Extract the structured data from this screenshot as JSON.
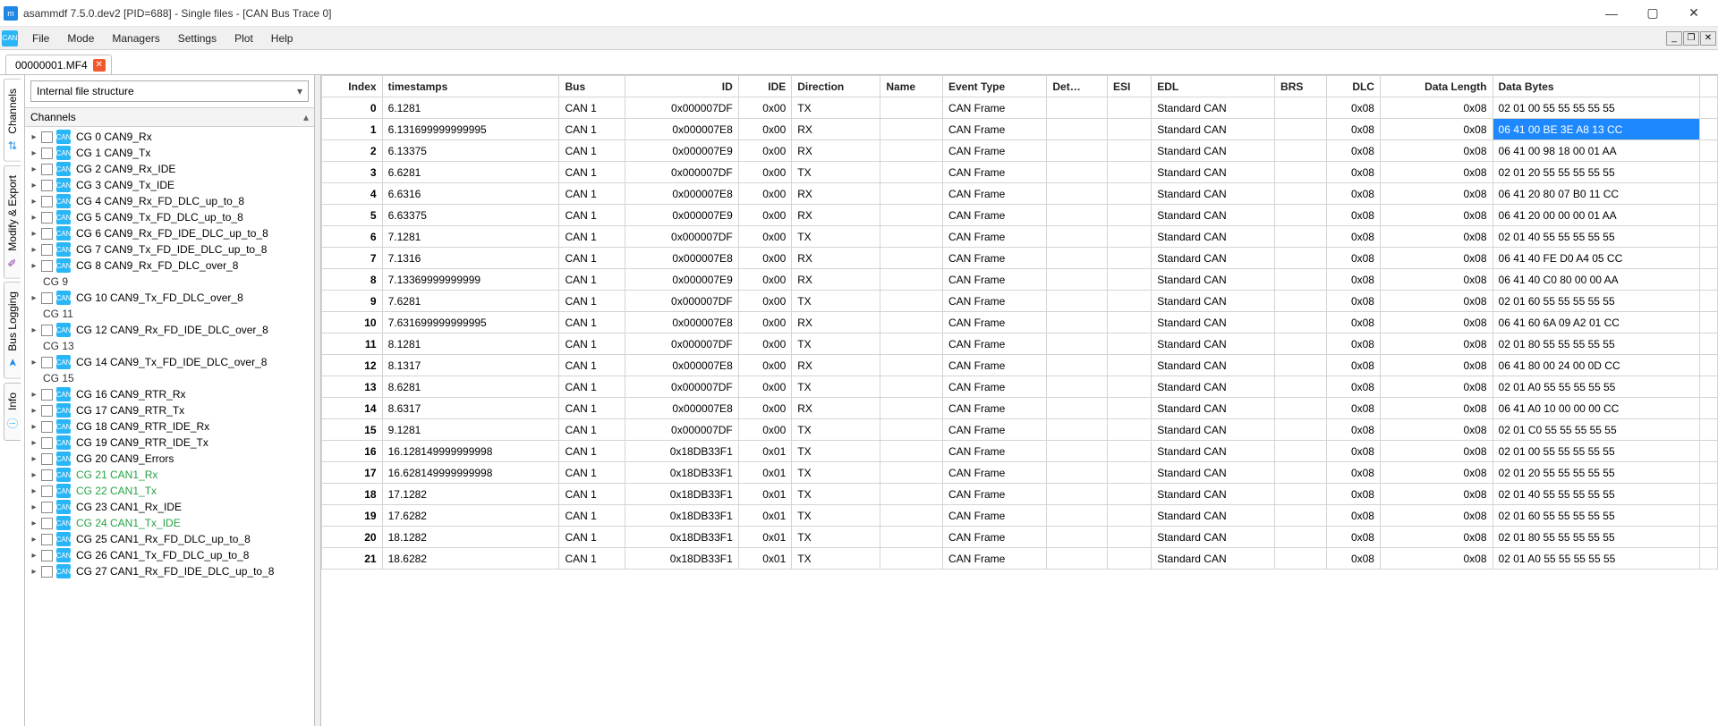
{
  "window": {
    "title": "asammdf 7.5.0.dev2 [PID=688] - Single files - [CAN Bus Trace 0]"
  },
  "menu": {
    "items": [
      "File",
      "Mode",
      "Managers",
      "Settings",
      "Plot",
      "Help"
    ]
  },
  "filetab": {
    "name": "00000001.MF4"
  },
  "side_tabs": [
    "Channels",
    "Modify & Export",
    "Bus Logging",
    "Info"
  ],
  "combo": {
    "value": "Internal file structure"
  },
  "panel_header": "Channels",
  "tree": [
    {
      "label": "CG 0 CAN9_Rx",
      "leaf": true
    },
    {
      "label": "CG 1 CAN9_Tx",
      "leaf": true
    },
    {
      "label": "CG 2 CAN9_Rx_IDE",
      "leaf": true
    },
    {
      "label": "CG 3 CAN9_Tx_IDE",
      "leaf": true
    },
    {
      "label": "CG 4 CAN9_Rx_FD_DLC_up_to_8",
      "leaf": true
    },
    {
      "label": "CG 5 CAN9_Tx_FD_DLC_up_to_8",
      "leaf": true
    },
    {
      "label": "CG 6 CAN9_Rx_FD_IDE_DLC_up_to_8",
      "leaf": true
    },
    {
      "label": "CG 7 CAN9_Tx_FD_IDE_DLC_up_to_8",
      "leaf": true
    },
    {
      "label": "CG 8 CAN9_Rx_FD_DLC_over_8",
      "leaf": true
    },
    {
      "label": "CG 9",
      "group": true
    },
    {
      "label": "CG 10 CAN9_Tx_FD_DLC_over_8",
      "leaf": true
    },
    {
      "label": "CG 11",
      "group": true
    },
    {
      "label": "CG 12 CAN9_Rx_FD_IDE_DLC_over_8",
      "leaf": true
    },
    {
      "label": "CG 13",
      "group": true
    },
    {
      "label": "CG 14 CAN9_Tx_FD_IDE_DLC_over_8",
      "leaf": true
    },
    {
      "label": "CG 15",
      "group": true
    },
    {
      "label": "CG 16 CAN9_RTR_Rx",
      "leaf": true
    },
    {
      "label": "CG 17 CAN9_RTR_Tx",
      "leaf": true
    },
    {
      "label": "CG 18 CAN9_RTR_IDE_Rx",
      "leaf": true
    },
    {
      "label": "CG 19 CAN9_RTR_IDE_Tx",
      "leaf": true
    },
    {
      "label": "CG 20 CAN9_Errors",
      "leaf": true
    },
    {
      "label": "CG 21 CAN1_Rx",
      "leaf": true,
      "hl": true
    },
    {
      "label": "CG 22 CAN1_Tx",
      "leaf": true,
      "hl": true
    },
    {
      "label": "CG 23 CAN1_Rx_IDE",
      "leaf": true
    },
    {
      "label": "CG 24 CAN1_Tx_IDE",
      "leaf": true,
      "hl": true
    },
    {
      "label": "CG 25 CAN1_Rx_FD_DLC_up_to_8",
      "leaf": true
    },
    {
      "label": "CG 26 CAN1_Tx_FD_DLC_up_to_8",
      "leaf": true
    },
    {
      "label": "CG 27 CAN1_Rx_FD_IDE_DLC_up_to_8",
      "leaf": true
    }
  ],
  "table": {
    "headers": [
      "Index",
      "timestamps",
      "Bus",
      "ID",
      "IDE",
      "Direction",
      "Name",
      "Event Type",
      "Det…",
      "ESI",
      "EDL",
      "BRS",
      "DLC",
      "Data Length",
      "Data Bytes"
    ],
    "align": [
      "right",
      "left",
      "left",
      "right",
      "right",
      "left",
      "left",
      "left",
      "left",
      "left",
      "left",
      "left",
      "right",
      "right",
      "left"
    ],
    "rows": [
      {
        "idx": "0",
        "ts": "6.1281",
        "bus": "CAN 1",
        "id": "0x000007DF",
        "ide": "0x00",
        "dir": "TX",
        "evt": "CAN Frame",
        "edl": "Standard CAN",
        "dlc": "0x08",
        "dlen": "0x08",
        "data": "02 01 00 55 55 55 55 55"
      },
      {
        "idx": "1",
        "ts": "6.131699999999995",
        "bus": "CAN 1",
        "id": "0x000007E8",
        "ide": "0x00",
        "dir": "RX",
        "evt": "CAN Frame",
        "edl": "Standard CAN",
        "dlc": "0x08",
        "dlen": "0x08",
        "data": "06 41 00 BE 3E A8 13 CC",
        "sel": true
      },
      {
        "idx": "2",
        "ts": "6.13375",
        "bus": "CAN 1",
        "id": "0x000007E9",
        "ide": "0x00",
        "dir": "RX",
        "evt": "CAN Frame",
        "edl": "Standard CAN",
        "dlc": "0x08",
        "dlen": "0x08",
        "data": "06 41 00 98 18 00 01 AA"
      },
      {
        "idx": "3",
        "ts": "6.6281",
        "bus": "CAN 1",
        "id": "0x000007DF",
        "ide": "0x00",
        "dir": "TX",
        "evt": "CAN Frame",
        "edl": "Standard CAN",
        "dlc": "0x08",
        "dlen": "0x08",
        "data": "02 01 20 55 55 55 55 55"
      },
      {
        "idx": "4",
        "ts": "6.6316",
        "bus": "CAN 1",
        "id": "0x000007E8",
        "ide": "0x00",
        "dir": "RX",
        "evt": "CAN Frame",
        "edl": "Standard CAN",
        "dlc": "0x08",
        "dlen": "0x08",
        "data": "06 41 20 80 07 B0 11 CC"
      },
      {
        "idx": "5",
        "ts": "6.63375",
        "bus": "CAN 1",
        "id": "0x000007E9",
        "ide": "0x00",
        "dir": "RX",
        "evt": "CAN Frame",
        "edl": "Standard CAN",
        "dlc": "0x08",
        "dlen": "0x08",
        "data": "06 41 20 00 00 00 01 AA"
      },
      {
        "idx": "6",
        "ts": "7.1281",
        "bus": "CAN 1",
        "id": "0x000007DF",
        "ide": "0x00",
        "dir": "TX",
        "evt": "CAN Frame",
        "edl": "Standard CAN",
        "dlc": "0x08",
        "dlen": "0x08",
        "data": "02 01 40 55 55 55 55 55"
      },
      {
        "idx": "7",
        "ts": "7.1316",
        "bus": "CAN 1",
        "id": "0x000007E8",
        "ide": "0x00",
        "dir": "RX",
        "evt": "CAN Frame",
        "edl": "Standard CAN",
        "dlc": "0x08",
        "dlen": "0x08",
        "data": "06 41 40 FE D0 A4 05 CC"
      },
      {
        "idx": "8",
        "ts": "7.13369999999999",
        "bus": "CAN 1",
        "id": "0x000007E9",
        "ide": "0x00",
        "dir": "RX",
        "evt": "CAN Frame",
        "edl": "Standard CAN",
        "dlc": "0x08",
        "dlen": "0x08",
        "data": "06 41 40 C0 80 00 00 AA"
      },
      {
        "idx": "9",
        "ts": "7.6281",
        "bus": "CAN 1",
        "id": "0x000007DF",
        "ide": "0x00",
        "dir": "TX",
        "evt": "CAN Frame",
        "edl": "Standard CAN",
        "dlc": "0x08",
        "dlen": "0x08",
        "data": "02 01 60 55 55 55 55 55"
      },
      {
        "idx": "10",
        "ts": "7.631699999999995",
        "bus": "CAN 1",
        "id": "0x000007E8",
        "ide": "0x00",
        "dir": "RX",
        "evt": "CAN Frame",
        "edl": "Standard CAN",
        "dlc": "0x08",
        "dlen": "0x08",
        "data": "06 41 60 6A 09 A2 01 CC"
      },
      {
        "idx": "11",
        "ts": "8.1281",
        "bus": "CAN 1",
        "id": "0x000007DF",
        "ide": "0x00",
        "dir": "TX",
        "evt": "CAN Frame",
        "edl": "Standard CAN",
        "dlc": "0x08",
        "dlen": "0x08",
        "data": "02 01 80 55 55 55 55 55"
      },
      {
        "idx": "12",
        "ts": "8.1317",
        "bus": "CAN 1",
        "id": "0x000007E8",
        "ide": "0x00",
        "dir": "RX",
        "evt": "CAN Frame",
        "edl": "Standard CAN",
        "dlc": "0x08",
        "dlen": "0x08",
        "data": "06 41 80 00 24 00 0D CC"
      },
      {
        "idx": "13",
        "ts": "8.6281",
        "bus": "CAN 1",
        "id": "0x000007DF",
        "ide": "0x00",
        "dir": "TX",
        "evt": "CAN Frame",
        "edl": "Standard CAN",
        "dlc": "0x08",
        "dlen": "0x08",
        "data": "02 01 A0 55 55 55 55 55"
      },
      {
        "idx": "14",
        "ts": "8.6317",
        "bus": "CAN 1",
        "id": "0x000007E8",
        "ide": "0x00",
        "dir": "RX",
        "evt": "CAN Frame",
        "edl": "Standard CAN",
        "dlc": "0x08",
        "dlen": "0x08",
        "data": "06 41 A0 10 00 00 00 CC"
      },
      {
        "idx": "15",
        "ts": "9.1281",
        "bus": "CAN 1",
        "id": "0x000007DF",
        "ide": "0x00",
        "dir": "TX",
        "evt": "CAN Frame",
        "edl": "Standard CAN",
        "dlc": "0x08",
        "dlen": "0x08",
        "data": "02 01 C0 55 55 55 55 55"
      },
      {
        "idx": "16",
        "ts": "16.128149999999998",
        "bus": "CAN 1",
        "id": "0x18DB33F1",
        "ide": "0x01",
        "dir": "TX",
        "evt": "CAN Frame",
        "edl": "Standard CAN",
        "dlc": "0x08",
        "dlen": "0x08",
        "data": "02 01 00 55 55 55 55 55"
      },
      {
        "idx": "17",
        "ts": "16.628149999999998",
        "bus": "CAN 1",
        "id": "0x18DB33F1",
        "ide": "0x01",
        "dir": "TX",
        "evt": "CAN Frame",
        "edl": "Standard CAN",
        "dlc": "0x08",
        "dlen": "0x08",
        "data": "02 01 20 55 55 55 55 55"
      },
      {
        "idx": "18",
        "ts": "17.1282",
        "bus": "CAN 1",
        "id": "0x18DB33F1",
        "ide": "0x01",
        "dir": "TX",
        "evt": "CAN Frame",
        "edl": "Standard CAN",
        "dlc": "0x08",
        "dlen": "0x08",
        "data": "02 01 40 55 55 55 55 55"
      },
      {
        "idx": "19",
        "ts": "17.6282",
        "bus": "CAN 1",
        "id": "0x18DB33F1",
        "ide": "0x01",
        "dir": "TX",
        "evt": "CAN Frame",
        "edl": "Standard CAN",
        "dlc": "0x08",
        "dlen": "0x08",
        "data": "02 01 60 55 55 55 55 55"
      },
      {
        "idx": "20",
        "ts": "18.1282",
        "bus": "CAN 1",
        "id": "0x18DB33F1",
        "ide": "0x01",
        "dir": "TX",
        "evt": "CAN Frame",
        "edl": "Standard CAN",
        "dlc": "0x08",
        "dlen": "0x08",
        "data": "02 01 80 55 55 55 55 55"
      },
      {
        "idx": "21",
        "ts": "18.6282",
        "bus": "CAN 1",
        "id": "0x18DB33F1",
        "ide": "0x01",
        "dir": "TX",
        "evt": "CAN Frame",
        "edl": "Standard CAN",
        "dlc": "0x08",
        "dlen": "0x08",
        "data": "02 01 A0 55 55 55 55 55"
      }
    ]
  }
}
